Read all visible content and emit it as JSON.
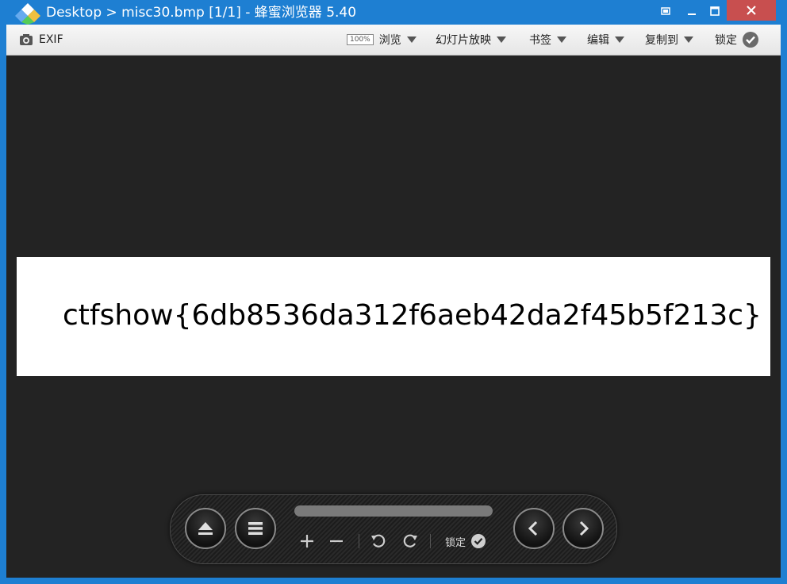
{
  "window": {
    "title": "Desktop > misc30.bmp [1/1] - 蜂蜜浏览器 5.40",
    "close_color": "#c84f4f",
    "accent": "#1e7fd2"
  },
  "toolbar": {
    "exif_label": "EXIF",
    "zoom_badge": "100%",
    "browse_label": "浏览",
    "slideshow_label": "幻灯片放映",
    "bookmarks_label": "书签",
    "edit_label": "编辑",
    "copy_to_label": "复制到",
    "lock_label": "锁定"
  },
  "image": {
    "text": "ctfshow{6db8536da312f6aeb42da2f45b5f213c}"
  },
  "controls": {
    "lock_label": "锁定",
    "icons": [
      "eject-icon",
      "menu-icon",
      "zoom-in-icon",
      "zoom-out-icon",
      "rotate-left-icon",
      "rotate-right-icon",
      "check-icon",
      "previous-icon",
      "next-icon"
    ]
  }
}
